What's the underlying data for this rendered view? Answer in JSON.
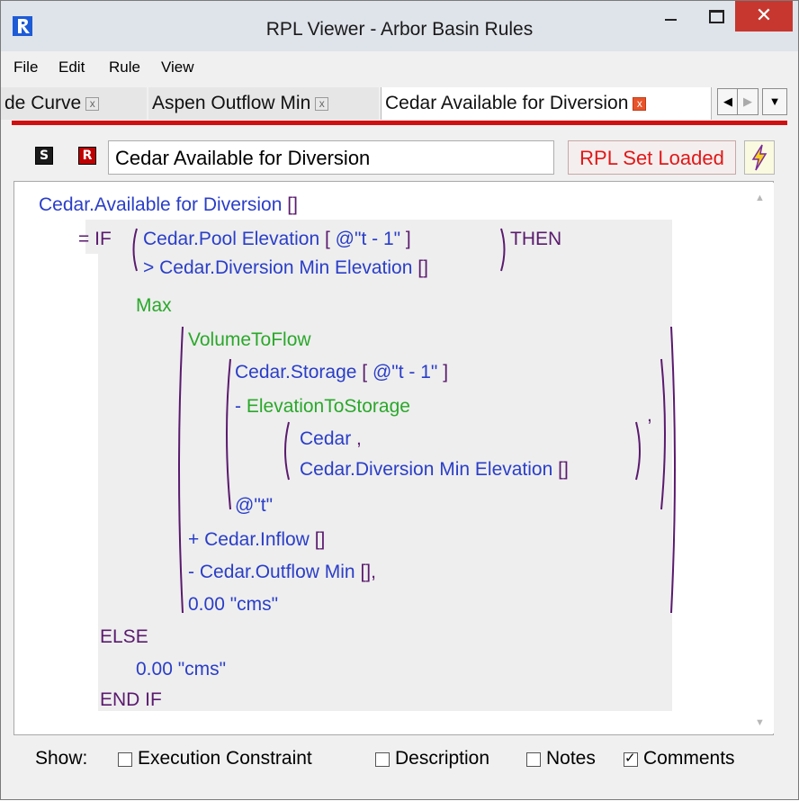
{
  "window": {
    "title": "RPL Viewer - Arbor Basin Rules",
    "close_glyph": "✕"
  },
  "menu": [
    "File",
    "Edit",
    "Rule",
    "View"
  ],
  "tabs": [
    {
      "label": "de Curve",
      "close": "x",
      "active": false
    },
    {
      "label": "Aspen Outflow Min",
      "close": "x",
      "active": false
    },
    {
      "label": "Cedar Available for Diversion",
      "close": "x",
      "active": true
    }
  ],
  "tab_nav": {
    "left": "◀",
    "right": "▶",
    "dropdown": "▼"
  },
  "rule_header": {
    "s_badge": "S",
    "r_badge": "R",
    "rule_name": "Cedar Available for Diversion",
    "status": "RPL Set Loaded"
  },
  "code": {
    "l1_var": "Cedar.Available for Diversion",
    "l2_eq": "=",
    "l2_if": "IF",
    "l2_var": "Cedar.Pool Elevation",
    "l2_arg": "@\"t - 1\"",
    "l2_then": "THEN",
    "l3_op": ">",
    "l3_var": "Cedar.Diversion Min Elevation",
    "l4_fn": "Max",
    "l5_fn": "VolumeToFlow",
    "l6_var": "Cedar.Storage",
    "l6_arg": "@\"t - 1\"",
    "l7_op": "-",
    "l7_fn": "ElevationToStorage",
    "l7_comma": ",",
    "l8_var": "Cedar",
    "l8_comma": ",",
    "l9_var": "Cedar.Diversion Min Elevation",
    "l10_arg": "@\"t\"",
    "l11_op": "+",
    "l11_var": "Cedar.Inflow",
    "l12_op": "-",
    "l12_var": "Cedar.Outflow Min",
    "l12_comma": ",",
    "l13_val": "0.00 \"cms\"",
    "l14_else": "ELSE",
    "l15_val": "0.00 \"cms\"",
    "l16_endif": "END IF",
    "empty_brackets": "[]"
  },
  "show_bar": {
    "label": "Show:",
    "options": [
      {
        "label": "Execution Constraint",
        "checked": false
      },
      {
        "label": "Description",
        "checked": false
      },
      {
        "label": "Notes",
        "checked": false
      },
      {
        "label": "Comments",
        "checked": true
      }
    ],
    "check_glyph": "✓"
  },
  "colors": {
    "variable": "#2a3ec8",
    "keyword": "#5a1a6e",
    "function": "#2aa82a",
    "status_text": "#e01818",
    "accent_line": "#d01010",
    "close_button": "#c7372f"
  }
}
